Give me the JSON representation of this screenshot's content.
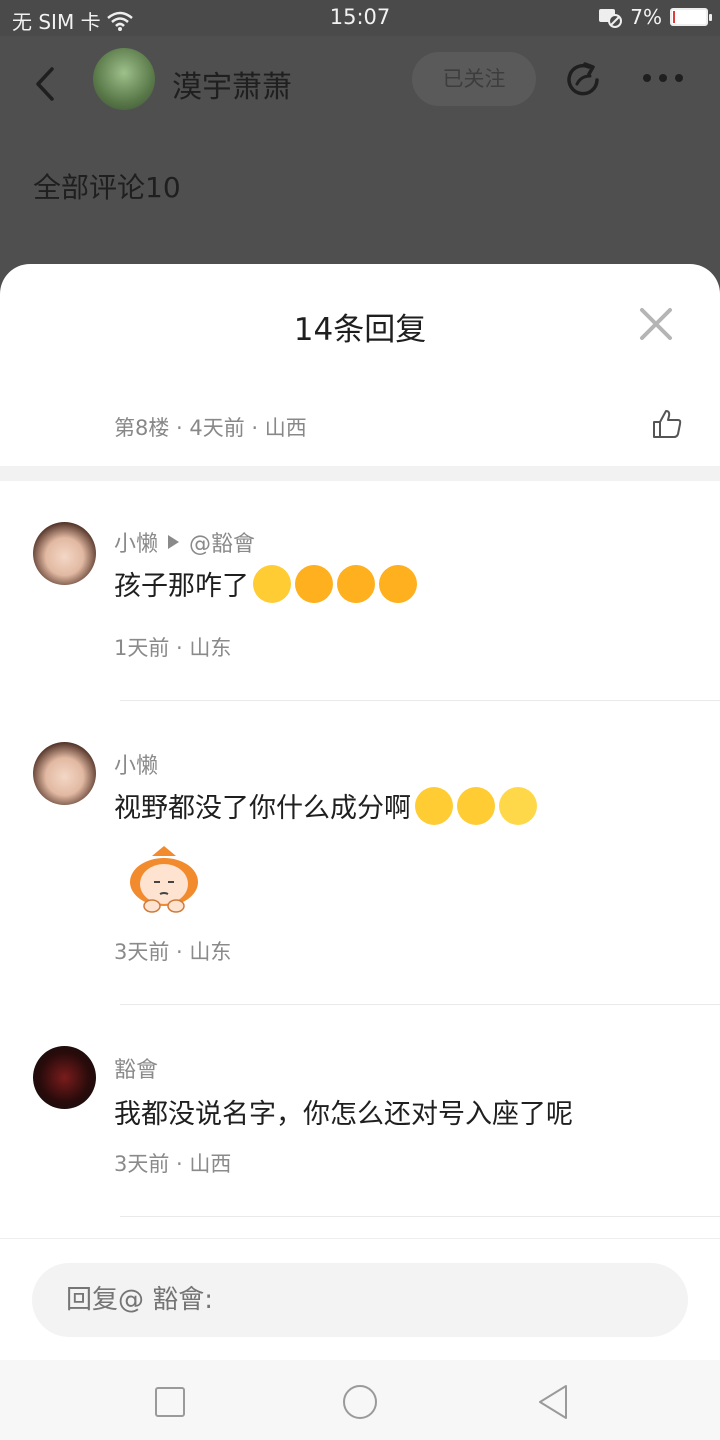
{
  "status_bar": {
    "carrier": "无 SIM 卡",
    "time": "15:07",
    "battery_percent": "7%",
    "battery_level": 0.07,
    "icons": [
      "wifi-icon",
      "no-sync-icon",
      "battery-icon"
    ]
  },
  "background_header": {
    "username": "漠宇萧萧",
    "follow_label": "已关注",
    "all_comments": "全部评论10"
  },
  "sheet": {
    "title": "14条回复",
    "floor_meta": "第8楼 · 4天前 · 山西"
  },
  "replies": [
    {
      "name": "小懒",
      "reply_to": "@豁會",
      "text": "孩子那咋了",
      "emojis": [
        "grinning-face",
        "rolling-on-floor-laughing",
        "rolling-on-floor-laughing",
        "rolling-on-floor-laughing"
      ],
      "meta": "1天前 · 山东"
    },
    {
      "name": "小懒",
      "text": "视野都没了你什么成分啊",
      "emojis": [
        "face-with-tears-of-joy",
        "face-with-tears-of-joy",
        "face-with-rolling-eyes"
      ],
      "sticker": "cartoon-girl-sticker",
      "meta": "3天前 · 山东"
    },
    {
      "name": "豁會",
      "text": "我都没说名字，你怎么还对号入座了呢",
      "meta": "3天前 · 山西"
    }
  ],
  "input": {
    "placeholder": "回复@ 豁會:"
  },
  "colors": {
    "dim_overlay": "#4f4f4f",
    "meta_gray": "#8a8a8a",
    "battery_low": "#e23b3b"
  }
}
